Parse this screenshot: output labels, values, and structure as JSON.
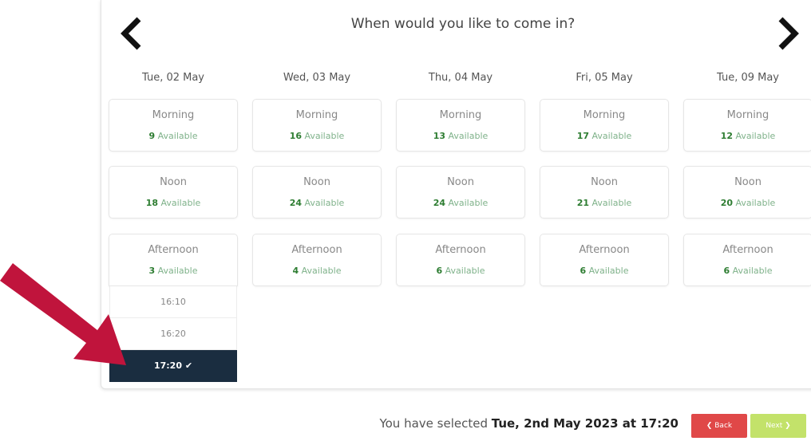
{
  "header": {
    "title": "When would you like to come in?"
  },
  "days": [
    {
      "label": "Tue, 02 May",
      "slots": [
        {
          "period": "Morning",
          "count": "9",
          "avail": "Available"
        },
        {
          "period": "Noon",
          "count": "18",
          "avail": "Available"
        },
        {
          "period": "Afternoon",
          "count": "3",
          "avail": "Available"
        }
      ]
    },
    {
      "label": "Wed, 03 May",
      "slots": [
        {
          "period": "Morning",
          "count": "16",
          "avail": "Available"
        },
        {
          "period": "Noon",
          "count": "24",
          "avail": "Available"
        },
        {
          "period": "Afternoon",
          "count": "4",
          "avail": "Available"
        }
      ]
    },
    {
      "label": "Thu, 04 May",
      "slots": [
        {
          "period": "Morning",
          "count": "13",
          "avail": "Available"
        },
        {
          "period": "Noon",
          "count": "24",
          "avail": "Available"
        },
        {
          "period": "Afternoon",
          "count": "6",
          "avail": "Available"
        }
      ]
    },
    {
      "label": "Fri, 05 May",
      "slots": [
        {
          "period": "Morning",
          "count": "17",
          "avail": "Available"
        },
        {
          "period": "Noon",
          "count": "21",
          "avail": "Available"
        },
        {
          "period": "Afternoon",
          "count": "6",
          "avail": "Available"
        }
      ]
    },
    {
      "label": "Tue, 09 May",
      "slots": [
        {
          "period": "Morning",
          "count": "12",
          "avail": "Available"
        },
        {
          "period": "Noon",
          "count": "20",
          "avail": "Available"
        },
        {
          "period": "Afternoon",
          "count": "6",
          "avail": "Available"
        }
      ]
    }
  ],
  "times": [
    {
      "label": "16:10",
      "selected": false
    },
    {
      "label": "16:20",
      "selected": false
    },
    {
      "label": "17:20 ✔",
      "selected": true
    }
  ],
  "footer": {
    "prefix": "You have selected ",
    "selection": "Tue, 2nd May 2023 at 17:20",
    "back_label": "❮ Back",
    "next_label": "Next ❯"
  },
  "colors": {
    "accent_dark": "#1a2d40",
    "back": "#e04848",
    "next": "#c3e26a",
    "count": "#2e7d32",
    "annotation_arrow": "#c0143c"
  },
  "icons": {
    "prev": "chevron-left-icon",
    "next": "chevron-right-icon",
    "annotation": "red-arrow-icon",
    "check": "checkmark-icon"
  }
}
